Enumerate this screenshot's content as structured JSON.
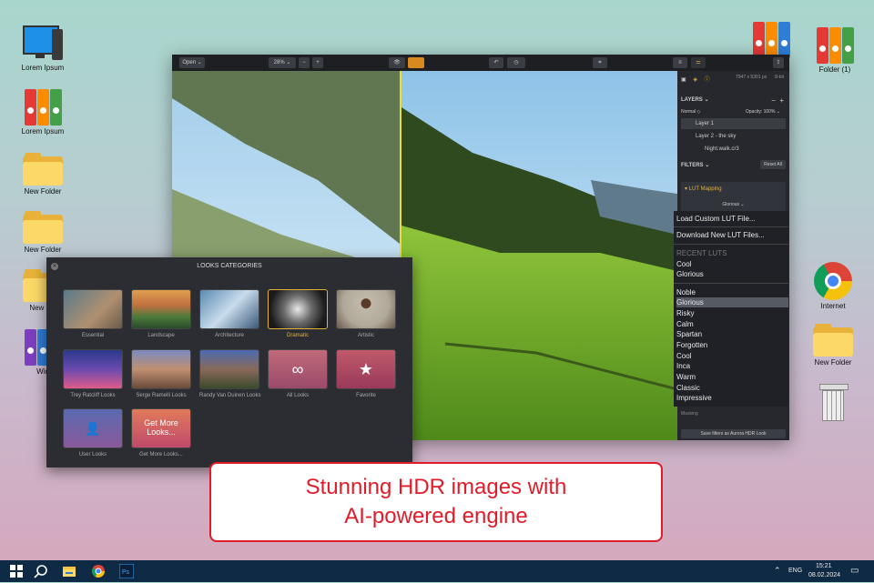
{
  "desktop": {
    "icons_left": [
      {
        "label": "Lorem Ipsum",
        "icon": "computer-icon"
      },
      {
        "label": "Lorem Ipsum",
        "icon": "binders-icon"
      },
      {
        "label": "New Folder",
        "icon": "folder-icon"
      },
      {
        "label": "New Folder",
        "icon": "folder-icon"
      },
      {
        "label": "New Fol",
        "icon": "folder-icon"
      },
      {
        "label": "Win",
        "icon": "winrar-icon"
      }
    ],
    "icons_right": [
      {
        "label": "",
        "icon": "winrar-icon"
      },
      {
        "label": "Folder (1)",
        "icon": "binders-icon"
      },
      {
        "label": "Internet",
        "icon": "chrome-icon"
      },
      {
        "label": "New Folder",
        "icon": "folder-icon"
      },
      {
        "label": "",
        "icon": "recycle-bin-icon"
      }
    ]
  },
  "app": {
    "toolbar": {
      "open": "Open ⌄",
      "zoom": "28% ⌄",
      "minus": "−",
      "plus": "+"
    },
    "panel": {
      "info": "7947 x 5301 px",
      "bit": "8-bit",
      "layers_title": "LAYERS ⌄",
      "blend": "Normal ◇",
      "opacity": "Opacity: 100% ⌄",
      "layers": [
        "Layer 1",
        "Layer 2 - the sky",
        "Night.walk.cr3"
      ],
      "filters_title": "FILTERS ⌄",
      "reset_all": "Reset All",
      "lut": "▾ LUT Mapping",
      "lut_value": "Glorious ⌄",
      "masking": "Masking",
      "save_filters": "Save filters as Aurora HDR Look"
    },
    "lut_menu": {
      "load": "Load Custom LUT File...",
      "download": "Download New LUT Files...",
      "recent_header": "RECENT LUTS",
      "recent": [
        "Cool",
        "Glorious"
      ],
      "luts": [
        "Noble",
        "Glorious",
        "Risky",
        "Calm",
        "Spartan",
        "Forgotten",
        "Cool",
        "Inca",
        "Warm",
        "Classic",
        "Impressive"
      ],
      "selected": "Glorious"
    }
  },
  "looks": {
    "title": "LOOKS CATEGORIES",
    "tiles": [
      {
        "caption": "Essential"
      },
      {
        "caption": "Landscape"
      },
      {
        "caption": "Architecture"
      },
      {
        "caption": "Dramatic",
        "selected": true
      },
      {
        "caption": "Artistic"
      },
      {
        "caption": "Trey Ratcliff Looks"
      },
      {
        "caption": "Serge Ramelli Looks"
      },
      {
        "caption": "Randy Van Duinen Looks"
      },
      {
        "caption": "All Looks",
        "glyph": "∞"
      },
      {
        "caption": "Favorite",
        "glyph": "★"
      },
      {
        "caption": "User Looks",
        "glyph": "👤"
      },
      {
        "caption": "Get More Looks...",
        "glyph_text": "Get More\nLooks..."
      }
    ]
  },
  "callout": {
    "line1": "Stunning HDR images with",
    "line2": "AI-powered engine"
  },
  "taskbar": {
    "lang": "ENG",
    "time": "15:21",
    "date": "08.02.2024"
  }
}
